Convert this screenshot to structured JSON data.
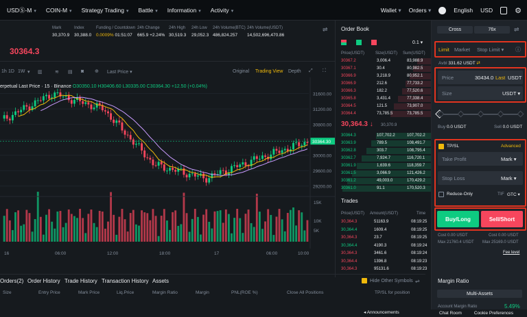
{
  "nav": {
    "items": [
      {
        "label": "USDⓈ-M"
      },
      {
        "label": "COIN-M"
      },
      {
        "label": "Strategy Trading"
      },
      {
        "label": "Battle"
      },
      {
        "label": "Information"
      },
      {
        "label": "Activity"
      }
    ],
    "wallet": "Wallet",
    "orders": "Orders",
    "language": "English",
    "currency": "USD"
  },
  "ticker": {
    "price": "30364.3",
    "mark_label": "Mark",
    "mark": "30,370.9",
    "index_label": "Index",
    "index": "30,388.0",
    "funding_label": "Funding / Countdown",
    "funding_rate": "0.0009%",
    "countdown": "01:51:07",
    "change_label": "24h Change",
    "change": "665.9 +2.24%",
    "high_label": "24h High",
    "high": "30,519.3",
    "low_label": "24h Low",
    "low": "29,052.3",
    "vol_btc_label": "24h Volume(BTC)",
    "vol_btc": "486,824.257",
    "vol_usdt_label": "24h Volume(USDT)",
    "vol_usdt": "14,502,696,470.86"
  },
  "chart_toolbar": {
    "interval_15m": "1D",
    "interval_1d": "1D",
    "interval_1w": "1W",
    "price_type": "Last Price",
    "views": [
      "Original",
      "Trading View",
      "Depth"
    ]
  },
  "chart": {
    "legend": "erpetual Last Price · 15 · Binance",
    "ohlc": "O30350.10 H30406.60 L30335.00 C30364.30 +12.50 (+0.04%)",
    "current_price_tag": "30364.30",
    "price_ticks": [
      "31600.00",
      "31200.00",
      "30800.00",
      "30400.00",
      "30000.00",
      "29600.00",
      "29200.00"
    ],
    "volume_ticks": [
      "15K",
      "10K",
      "5K"
    ],
    "time_ticks": [
      "16",
      "06:00",
      "12:00",
      "18:00",
      "17",
      "06:00",
      "10:00"
    ],
    "clock": "08:19:25 (UTC+2)",
    "scale_opts": [
      "%",
      "log",
      "auto"
    ]
  },
  "chart_data": {
    "type": "line",
    "title": "",
    "ylim": [
      29000,
      31700
    ],
    "x": [
      "16",
      "06:00",
      "12:00",
      "18:00",
      "17",
      "06:00",
      "10:00"
    ],
    "series": [
      {
        "values": [
          30900,
          31600,
          31200,
          29750,
          29400,
          29900,
          30350
        ]
      }
    ]
  },
  "orderbook": {
    "title": "Order Book",
    "precision": "0.1",
    "headers": [
      "Price(USDT)",
      "Size(USDT)",
      "Sum(USDT)"
    ],
    "asks": [
      [
        "30367.2",
        "3,006.4",
        "83,988.9"
      ],
      [
        "30367.1",
        "30.4",
        "80,982.5"
      ],
      [
        "30366.9",
        "3,218.9",
        "80,952.1"
      ],
      [
        "30366.9",
        "212.6",
        "77,733.2"
      ],
      [
        "30366.3",
        "182.2",
        "77,520.6"
      ],
      [
        "30365.8",
        "3,431.4",
        "77,338.4"
      ],
      [
        "30364.5",
        "121.5",
        "73,907.0"
      ],
      [
        "30364.4",
        "73,785.5",
        "73,785.5"
      ]
    ],
    "last_price": "30,364.3",
    "last_mark": "30,370.9",
    "bids": [
      [
        "30364.3",
        "107,702.2",
        "107,702.2"
      ],
      [
        "30363.9",
        "789.5",
        "108,491.7"
      ],
      [
        "30362.8",
        "303.7",
        "108,795.4"
      ],
      [
        "30362.7",
        "7,924.7",
        "116,720.1"
      ],
      [
        "30361.9",
        "1,639.6",
        "118,359.7"
      ],
      [
        "30361.5",
        "3,066.9",
        "121,426.2"
      ],
      [
        "30361.2",
        "49,003.0",
        "170,429.2"
      ],
      [
        "30361.0",
        "91.1",
        "170,520.3"
      ]
    ]
  },
  "trades": {
    "title": "Trades",
    "headers": [
      "Price(USDT)",
      "Amount(USDT)",
      "Time"
    ],
    "rows": [
      [
        "30,364.3",
        "51163.9",
        "08:19:25",
        "red"
      ],
      [
        "30,364.4",
        "1609.4",
        "08:19:25",
        "green"
      ],
      [
        "30,364.3",
        "23.7",
        "08:19:25",
        "red"
      ],
      [
        "30,364.4",
        "4190.3",
        "08:19:24",
        "green"
      ],
      [
        "30,364.3",
        "3461.6",
        "08:19:24",
        "red"
      ],
      [
        "30,364.4",
        "1396.8",
        "08:19:23",
        "red"
      ],
      [
        "30,364.3",
        "95131.6",
        "08:19:23",
        "red"
      ]
    ]
  },
  "panel": {
    "margin_mode": "Cross",
    "leverage": "76x",
    "order_types": [
      "Limit",
      "Market",
      "Stop Limit"
    ],
    "avail_label": "Avbl",
    "avail": "331.62 USDT",
    "price_label": "Price",
    "price_value": "30434.0",
    "price_last": "Last",
    "price_unit": "USDT",
    "size_label": "Size",
    "size_unit": "USDT",
    "buy_label": "Buy",
    "buy_value": "0.0 USDT",
    "sell_label": "Sell",
    "sell_value": "0.0 USDT",
    "tpsl_label": "TP/SL",
    "advanced": "Advanced",
    "take_profit": "Take Profit",
    "stop_loss": "Stop Loss",
    "mark": "Mark",
    "reduce_only": "Reduce-Only",
    "tif_label": "TIF",
    "tif": "GTC",
    "buy_button": "Buy/Long",
    "sell_button": "Sell/Short",
    "cost_buy": "Cost 0.00 USDT",
    "cost_sell": "Cost 0.00 USDT",
    "max_buy": "Max 21760.4 USDT",
    "max_sell": "Max 25169.0 USDT",
    "fee_level": "Fee level",
    "margin_ratio": "Margin Ratio",
    "multi_assets": "Multi-Assets",
    "account_margin": "Account Margin Ratio",
    "account_margin_value": "5.49%"
  },
  "bottom": {
    "tabs": [
      "Orders(2)",
      "Order History",
      "Trade History",
      "Transaction History",
      "Assets"
    ],
    "hide_other": "Hide Other Symbols",
    "columns": [
      "Size",
      "Entry Price",
      "Mark Price",
      "Liq.Price",
      "Margin Ratio",
      "Margin",
      "PNL(ROE %)",
      "Close All Positions",
      "TP/SL for position"
    ],
    "footer": [
      "Announcements",
      "Chat Room",
      "Cookie Preferences"
    ]
  },
  "colors": {
    "up": "#0ecb81",
    "down": "#f6465d",
    "accent": "#f0b90b",
    "highlight": "#e3341f"
  }
}
